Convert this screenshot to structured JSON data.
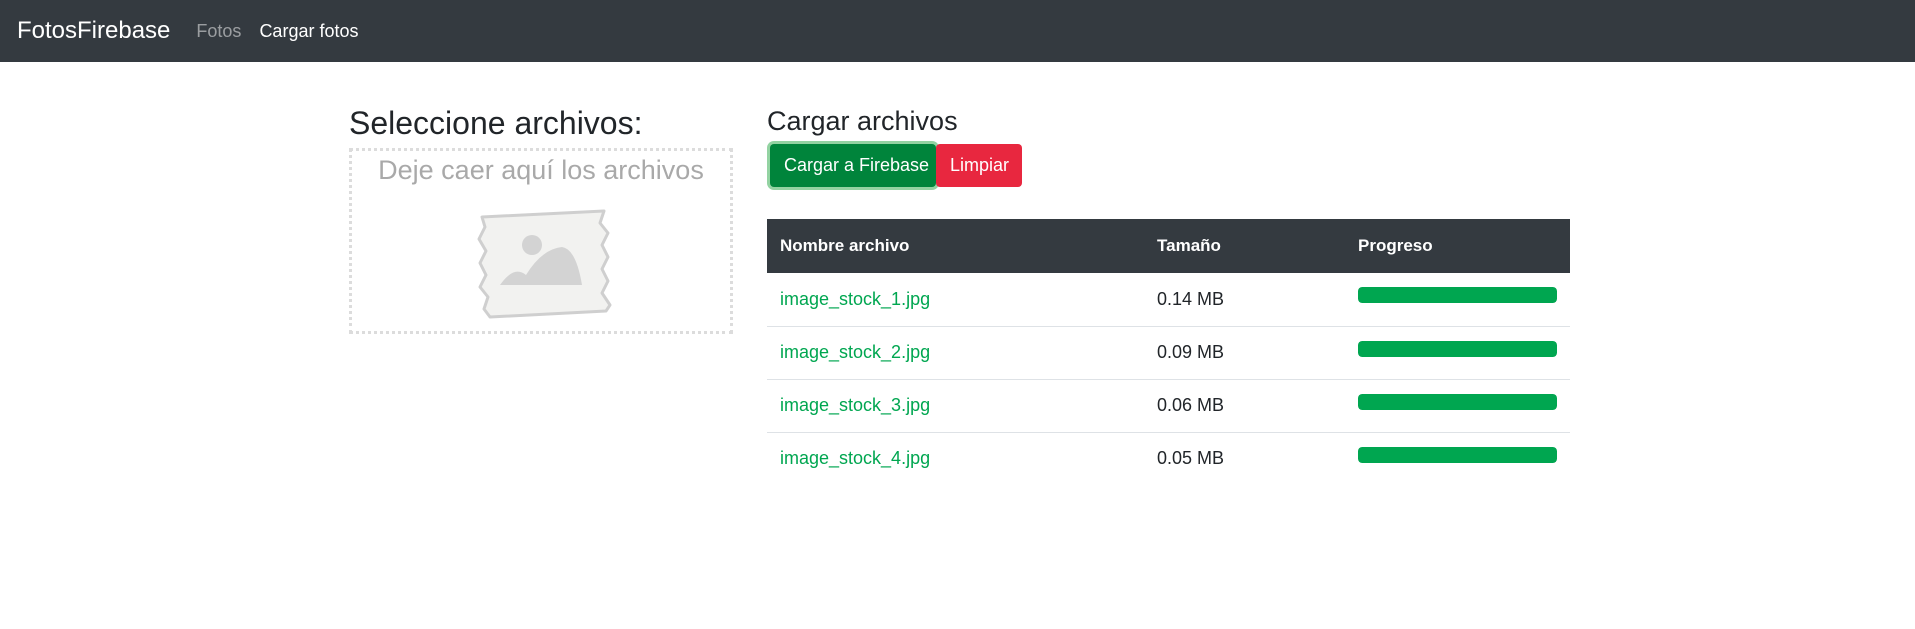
{
  "navbar": {
    "brand": "FotosFirebase",
    "links": [
      {
        "label": "Fotos",
        "active": false
      },
      {
        "label": "Cargar fotos",
        "active": true
      }
    ]
  },
  "left": {
    "title": "Seleccione archivos:",
    "drop_text": "Deje caer aquí los archivos",
    "icon": "image-placeholder-icon"
  },
  "right": {
    "title": "Cargar archivos",
    "upload_button": "Cargar a Firebase",
    "clear_button": "Limpiar",
    "table": {
      "headers": [
        "Nombre archivo",
        "Tamaño",
        "Progreso"
      ],
      "rows": [
        {
          "name": "image_stock_1.jpg",
          "size": "0.14 MB",
          "progress": 100
        },
        {
          "name": "image_stock_2.jpg",
          "size": "0.09 MB",
          "progress": 100
        },
        {
          "name": "image_stock_3.jpg",
          "size": "0.06 MB",
          "progress": 100
        },
        {
          "name": "image_stock_4.jpg",
          "size": "0.05 MB",
          "progress": 100
        }
      ]
    }
  },
  "colors": {
    "navbar": "#343a40",
    "success": "#00843b",
    "danger": "#e8273f",
    "link": "#00a650",
    "progress": "#00a650"
  }
}
